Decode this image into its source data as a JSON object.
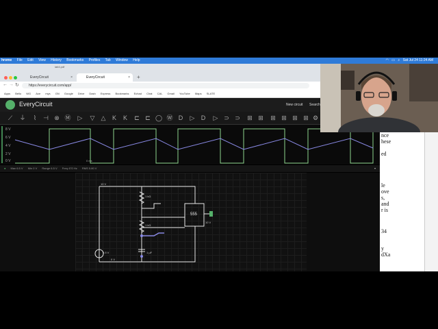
{
  "menubar": {
    "app": "hrome",
    "items": [
      "File",
      "Edit",
      "View",
      "History",
      "Bookmarks",
      "Profiles",
      "Tab",
      "Window",
      "Help"
    ],
    "clock": "Sat Jul 24  11:24 AM"
  },
  "browser": {
    "window_title": "lab4.pdf",
    "tabs": [
      {
        "label": "EveryCircuit",
        "active": false
      },
      {
        "label": "EveryCircuit",
        "active": true
      }
    ],
    "url": "https://everycircuit.com/app/",
    "bookmarks": [
      "Apps",
      "Bello",
      "WG",
      "Ace",
      "mys",
      "GN",
      "Google",
      "Drive",
      "Dash",
      "Express",
      "Bookmarks",
      "Echad",
      "Chat",
      "CAL",
      "Gmail",
      "YouTube",
      "Maps",
      "SLATE"
    ]
  },
  "app": {
    "title": "EveryCircuit",
    "header_buttons": [
      "New circuit",
      "Search"
    ]
  },
  "scope": {
    "y_labels": [
      "8 V",
      "6 V",
      "4 V",
      "2 V",
      "0 V"
    ],
    "time_label": "0 ms",
    "status": [
      "Max 6.5 V",
      "Min 0 V",
      "Range 6.5 V",
      "Freq 470 Hz",
      "RMS 5.80 V"
    ]
  },
  "circuit": {
    "supply": "10 V",
    "ground": "0 V",
    "r1": "1 kΩ",
    "r2": "1 kΩ",
    "cap": "1 µF",
    "chip": "555",
    "output": "10 V",
    "node_v": "0.5 V"
  },
  "document_fragments": [
    "nce",
    "hese",
    "ed",
    "le",
    "ove",
    "s,",
    "and",
    "r is",
    "34",
    "y",
    "dXa"
  ],
  "colors": {
    "menubar": "#2f7bd8",
    "trace_square": "#8fd68f",
    "trace_tri": "#8a8ae6",
    "accent_green": "#55b06a"
  }
}
